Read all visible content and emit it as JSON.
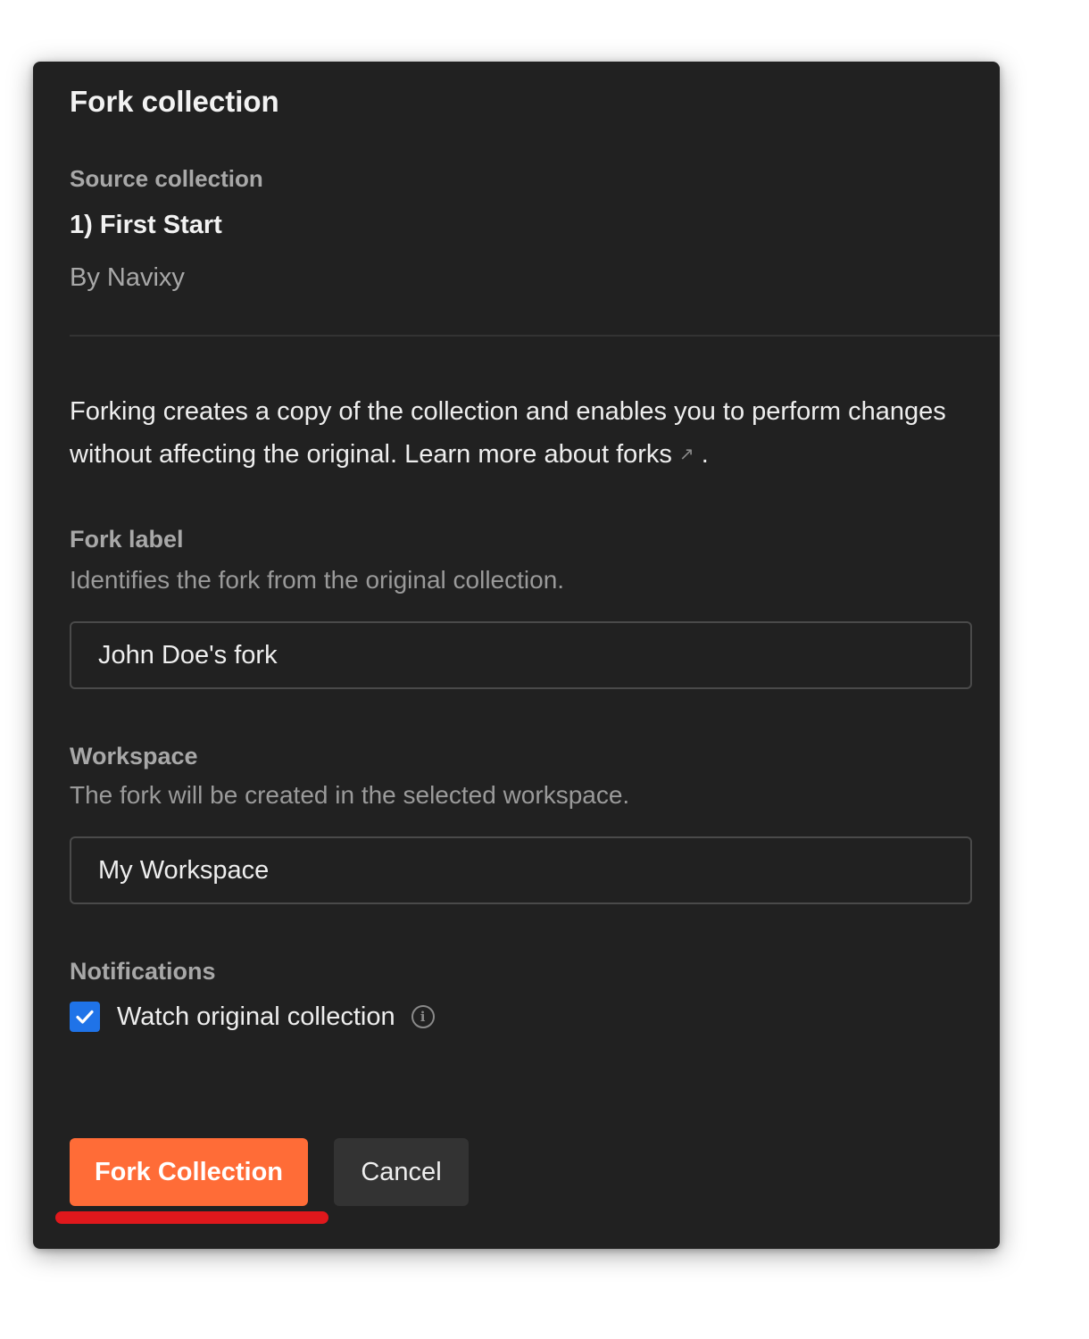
{
  "dialog": {
    "title": "Fork collection",
    "source": {
      "heading": "Source collection",
      "name": "1) First Start",
      "owner": "By Navixy"
    },
    "description": {
      "text": "Forking creates a copy of the collection and enables you to perform changes without affecting the original. Learn more about forks",
      "link_icon": "external-link-icon",
      "suffix": "."
    },
    "fork_label": {
      "label": "Fork label",
      "help": "Identifies the fork from the original collection.",
      "value": "John Doe's fork"
    },
    "workspace": {
      "label": "Workspace",
      "help": "The fork will be created in the selected workspace.",
      "value": "My Workspace"
    },
    "notifications": {
      "label": "Notifications",
      "watch_label": "Watch original collection",
      "watch_checked": true,
      "info_icon": "info-icon"
    },
    "actions": {
      "fork_label": "Fork Collection",
      "cancel_label": "Cancel"
    }
  },
  "colors": {
    "dialog_bg": "#212121",
    "primary": "#ff6c37",
    "checkbox": "#1f73e8",
    "annotation_underline": "#e0181c"
  }
}
